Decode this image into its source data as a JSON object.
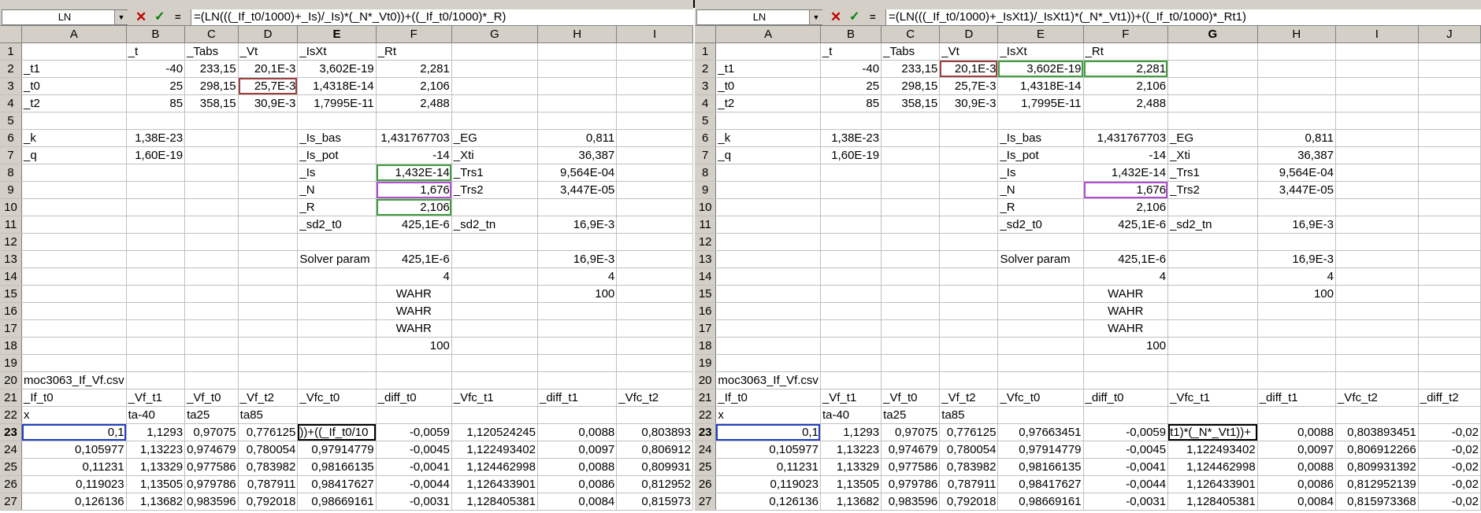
{
  "left": {
    "name_box": "LN",
    "formula": "=(LN(((_If_t0/1000)+_Is)/_Is)*(_N*_Vt0))+((_If_t0/1000)*_R)",
    "columns": [
      "A",
      "B",
      "C",
      "D",
      "E",
      "F",
      "G",
      "H",
      "I"
    ],
    "selected_column": "E",
    "selected_row": "23",
    "rows": [
      {
        "n": "1",
        "c": [
          "",
          "_t",
          "_Tabs",
          "_Vt",
          "_IsXt",
          "_Rt",
          "",
          "",
          ""
        ]
      },
      {
        "n": "2",
        "c": [
          "_t1",
          "-40",
          "233,15",
          "20,1E-3",
          "3,602E-19",
          "2,281",
          "",
          "",
          ""
        ]
      },
      {
        "n": "3",
        "c": [
          "_t0",
          "25",
          "298,15",
          "25,7E-3",
          "1,4318E-14",
          "2,106",
          "",
          "",
          ""
        ]
      },
      {
        "n": "4",
        "c": [
          "_t2",
          "85",
          "358,15",
          "30,9E-3",
          "1,7995E-11",
          "2,488",
          "",
          "",
          ""
        ]
      },
      {
        "n": "5",
        "c": [
          "",
          "",
          "",
          "",
          "",
          "",
          "",
          "",
          ""
        ]
      },
      {
        "n": "6",
        "c": [
          "_k",
          "1,38E-23",
          "",
          "",
          "_Is_bas",
          "1,431767703",
          "_EG",
          "0,811",
          ""
        ]
      },
      {
        "n": "7",
        "c": [
          "_q",
          "1,60E-19",
          "",
          "",
          "_Is_pot",
          "-14",
          "_Xti",
          "36,387",
          ""
        ]
      },
      {
        "n": "8",
        "c": [
          "",
          "",
          "",
          "",
          "_Is",
          "1,432E-14",
          "_Trs1",
          "9,564E-04",
          ""
        ]
      },
      {
        "n": "9",
        "c": [
          "",
          "",
          "",
          "",
          "_N",
          "1,676",
          "_Trs2",
          "3,447E-05",
          ""
        ]
      },
      {
        "n": "10",
        "c": [
          "",
          "",
          "",
          "",
          "_R",
          "2,106",
          "",
          "",
          ""
        ]
      },
      {
        "n": "11",
        "c": [
          "",
          "",
          "",
          "",
          "_sd2_t0",
          "425,1E-6",
          "_sd2_tn",
          "16,9E-3",
          ""
        ]
      },
      {
        "n": "12",
        "c": [
          "",
          "",
          "",
          "",
          "",
          "",
          "",
          "",
          ""
        ]
      },
      {
        "n": "13",
        "c": [
          "",
          "",
          "",
          "",
          "Solver param",
          "425,1E-6",
          "",
          "16,9E-3",
          ""
        ]
      },
      {
        "n": "14",
        "c": [
          "",
          "",
          "",
          "",
          "",
          "4",
          "",
          "4",
          ""
        ]
      },
      {
        "n": "15",
        "c": [
          "",
          "",
          "",
          "",
          "",
          "WAHR",
          "",
          "100",
          ""
        ]
      },
      {
        "n": "16",
        "c": [
          "",
          "",
          "",
          "",
          "",
          "WAHR",
          "",
          "",
          ""
        ]
      },
      {
        "n": "17",
        "c": [
          "",
          "",
          "",
          "",
          "",
          "WAHR",
          "",
          "",
          ""
        ]
      },
      {
        "n": "18",
        "c": [
          "",
          "",
          "",
          "",
          "",
          "100",
          "",
          "",
          ""
        ]
      },
      {
        "n": "19",
        "c": [
          "",
          "",
          "",
          "",
          "",
          "",
          "",
          "",
          ""
        ]
      },
      {
        "n": "20",
        "c": [
          "moc3063_If_Vf.csv",
          "",
          "",
          "",
          "",
          "",
          "",
          "",
          ""
        ]
      },
      {
        "n": "21",
        "c": [
          "_If_t0",
          "_Vf_t1",
          "_Vf_t0",
          "_Vf_t2",
          "_Vfc_t0",
          "_diff_t0",
          "_Vfc_t1",
          "_diff_t1",
          "_Vfc_t2"
        ]
      },
      {
        "n": "22",
        "c": [
          "x",
          "ta-40",
          "ta25",
          "ta85",
          "",
          "",
          "",
          "",
          ""
        ]
      },
      {
        "n": "23",
        "c": [
          "0,1",
          "1,1293",
          "0,97075",
          "0,776125",
          "))+((_If_t0/10",
          "-0,0059",
          "1,120524245",
          "0,0088",
          "0,803893"
        ]
      },
      {
        "n": "24",
        "c": [
          "0,105977",
          "1,13223",
          "0,974679",
          "0,780054",
          "0,97914779",
          "-0,0045",
          "1,122493402",
          "0,0097",
          "0,806912"
        ]
      },
      {
        "n": "25",
        "c": [
          "0,11231",
          "1,13329",
          "0,977586",
          "0,783982",
          "0,98166135",
          "-0,0041",
          "1,124462998",
          "0,0088",
          "0,809931"
        ]
      },
      {
        "n": "26",
        "c": [
          "0,119023",
          "1,13505",
          "0,979786",
          "0,787911",
          "0,98417627",
          "-0,0044",
          "1,126433901",
          "0,0086",
          "0,812952"
        ]
      },
      {
        "n": "27",
        "c": [
          "0,126136",
          "1,13682",
          "0,983596",
          "0,792018",
          "0,98669161",
          "-0,0031",
          "1,128405381",
          "0,0084",
          "0,815973"
        ]
      }
    ]
  },
  "right": {
    "name_box": "LN",
    "formula": "=(LN(((_If_t0/1000)+_IsXt1)/_IsXt1)*(_N*_Vt1))+((_If_t0/1000)*_Rt1)",
    "columns": [
      "A",
      "B",
      "C",
      "D",
      "E",
      "F",
      "G",
      "H",
      "I",
      "J"
    ],
    "selected_column": "G",
    "selected_row": "23",
    "rows": [
      {
        "n": "1",
        "c": [
          "",
          "_t",
          "_Tabs",
          "_Vt",
          "_IsXt",
          "_Rt",
          "",
          "",
          "",
          ""
        ]
      },
      {
        "n": "2",
        "c": [
          "_t1",
          "-40",
          "233,15",
          "20,1E-3",
          "3,602E-19",
          "2,281",
          "",
          "",
          "",
          ""
        ]
      },
      {
        "n": "3",
        "c": [
          "_t0",
          "25",
          "298,15",
          "25,7E-3",
          "1,4318E-14",
          "2,106",
          "",
          "",
          "",
          ""
        ]
      },
      {
        "n": "4",
        "c": [
          "_t2",
          "85",
          "358,15",
          "30,9E-3",
          "1,7995E-11",
          "2,488",
          "",
          "",
          "",
          ""
        ]
      },
      {
        "n": "5",
        "c": [
          "",
          "",
          "",
          "",
          "",
          "",
          "",
          "",
          "",
          ""
        ]
      },
      {
        "n": "6",
        "c": [
          "_k",
          "1,38E-23",
          "",
          "",
          "_Is_bas",
          "1,431767703",
          "_EG",
          "0,811",
          "",
          ""
        ]
      },
      {
        "n": "7",
        "c": [
          "_q",
          "1,60E-19",
          "",
          "",
          "_Is_pot",
          "-14",
          "_Xti",
          "36,387",
          "",
          ""
        ]
      },
      {
        "n": "8",
        "c": [
          "",
          "",
          "",
          "",
          "_Is",
          "1,432E-14",
          "_Trs1",
          "9,564E-04",
          "",
          ""
        ]
      },
      {
        "n": "9",
        "c": [
          "",
          "",
          "",
          "",
          "_N",
          "1,676",
          "_Trs2",
          "3,447E-05",
          "",
          ""
        ]
      },
      {
        "n": "10",
        "c": [
          "",
          "",
          "",
          "",
          "_R",
          "2,106",
          "",
          "",
          "",
          ""
        ]
      },
      {
        "n": "11",
        "c": [
          "",
          "",
          "",
          "",
          "_sd2_t0",
          "425,1E-6",
          "_sd2_tn",
          "16,9E-3",
          "",
          ""
        ]
      },
      {
        "n": "12",
        "c": [
          "",
          "",
          "",
          "",
          "",
          "",
          "",
          "",
          "",
          ""
        ]
      },
      {
        "n": "13",
        "c": [
          "",
          "",
          "",
          "",
          "Solver param",
          "425,1E-6",
          "",
          "16,9E-3",
          "",
          ""
        ]
      },
      {
        "n": "14",
        "c": [
          "",
          "",
          "",
          "",
          "",
          "4",
          "",
          "4",
          "",
          ""
        ]
      },
      {
        "n": "15",
        "c": [
          "",
          "",
          "",
          "",
          "",
          "WAHR",
          "",
          "100",
          "",
          ""
        ]
      },
      {
        "n": "16",
        "c": [
          "",
          "",
          "",
          "",
          "",
          "WAHR",
          "",
          "",
          "",
          ""
        ]
      },
      {
        "n": "17",
        "c": [
          "",
          "",
          "",
          "",
          "",
          "WAHR",
          "",
          "",
          "",
          ""
        ]
      },
      {
        "n": "18",
        "c": [
          "",
          "",
          "",
          "",
          "",
          "100",
          "",
          "",
          "",
          ""
        ]
      },
      {
        "n": "19",
        "c": [
          "",
          "",
          "",
          "",
          "",
          "",
          "",
          "",
          "",
          ""
        ]
      },
      {
        "n": "20",
        "c": [
          "moc3063_If_Vf.csv",
          "",
          "",
          "",
          "",
          "",
          "",
          "",
          "",
          ""
        ]
      },
      {
        "n": "21",
        "c": [
          "_If_t0",
          "_Vf_t1",
          "_Vf_t0",
          "_Vf_t2",
          "_Vfc_t0",
          "_diff_t0",
          "_Vfc_t1",
          "_diff_t1",
          "_Vfc_t2",
          "_diff_t2"
        ]
      },
      {
        "n": "22",
        "c": [
          "x",
          "ta-40",
          "ta25",
          "ta85",
          "",
          "",
          "",
          "",
          "",
          ""
        ]
      },
      {
        "n": "23",
        "c": [
          "0,1",
          "1,1293",
          "0,97075",
          "0,776125",
          "0,97663451",
          "-0,0059",
          "t1)*(_N*_Vt1))+",
          "0,0088",
          "0,803893451",
          "-0,02"
        ]
      },
      {
        "n": "24",
        "c": [
          "0,105977",
          "1,13223",
          "0,974679",
          "0,780054",
          "0,97914779",
          "-0,0045",
          "1,122493402",
          "0,0097",
          "0,806912266",
          "-0,02"
        ]
      },
      {
        "n": "25",
        "c": [
          "0,11231",
          "1,13329",
          "0,977586",
          "0,783982",
          "0,98166135",
          "-0,0041",
          "1,124462998",
          "0,0088",
          "0,809931392",
          "-0,02"
        ]
      },
      {
        "n": "26",
        "c": [
          "0,119023",
          "1,13505",
          "0,979786",
          "0,787911",
          "0,98417627",
          "-0,0044",
          "1,126433901",
          "0,0086",
          "0,812952139",
          "-0,02"
        ]
      },
      {
        "n": "27",
        "c": [
          "0,126136",
          "1,13682",
          "0,983596",
          "0,792018",
          "0,98669161",
          "-0,0031",
          "1,128405381",
          "0,0084",
          "0,815973368",
          "-0,02"
        ]
      }
    ]
  }
}
